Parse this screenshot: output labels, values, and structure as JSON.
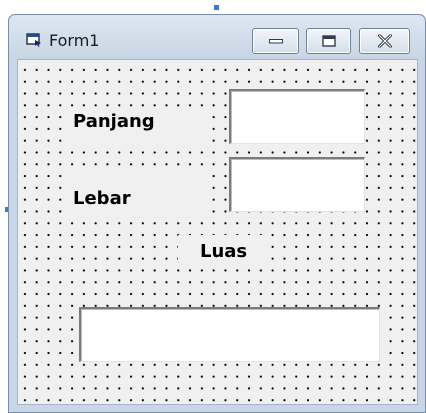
{
  "window": {
    "title": "Form1"
  },
  "form": {
    "labels": {
      "panjang": "Panjang",
      "lebar": "Lebar",
      "luas": "Luas"
    },
    "inputs": {
      "panjang_value": "",
      "lebar_value": "",
      "luas_value": ""
    }
  },
  "icons": {
    "app": "form-icon",
    "minimize": "minimize-icon",
    "maximize": "maximize-icon",
    "close": "close-icon"
  },
  "colors": {
    "client_background": "#f0f0f0",
    "title_bar": "#c9d6e6",
    "selection_handle": "#3a78d8"
  }
}
